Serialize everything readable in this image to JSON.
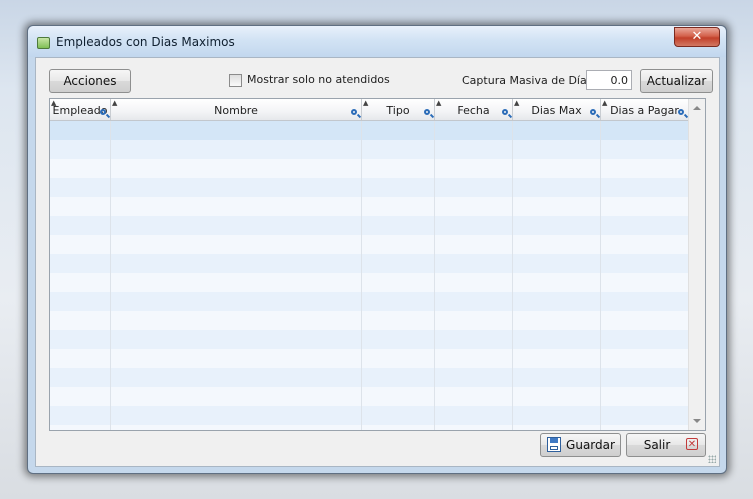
{
  "window": {
    "title": "Empleados con Dias Maximos",
    "close_label": "✕"
  },
  "toolbar": {
    "acciones_label": "Acciones",
    "checkbox_label": "Mostrar solo no atendidos",
    "checkbox_checked": false,
    "captura_label": "Captura Masiva de Días:",
    "captura_value": "0.0",
    "actualizar_label": "Actualizar"
  },
  "grid": {
    "columns": [
      {
        "label": "Empleado"
      },
      {
        "label": "Nombre"
      },
      {
        "label": "Tipo"
      },
      {
        "label": "Fecha"
      },
      {
        "label": "Dias Max"
      },
      {
        "label": "Dias a Pagar"
      }
    ],
    "rows": []
  },
  "footer": {
    "guardar_label": "Guardar",
    "salir_label": "Salir"
  },
  "colors": {
    "accent": "#2b6cb8",
    "row_selected": "#d4e6f7",
    "close": "#c2402a"
  }
}
